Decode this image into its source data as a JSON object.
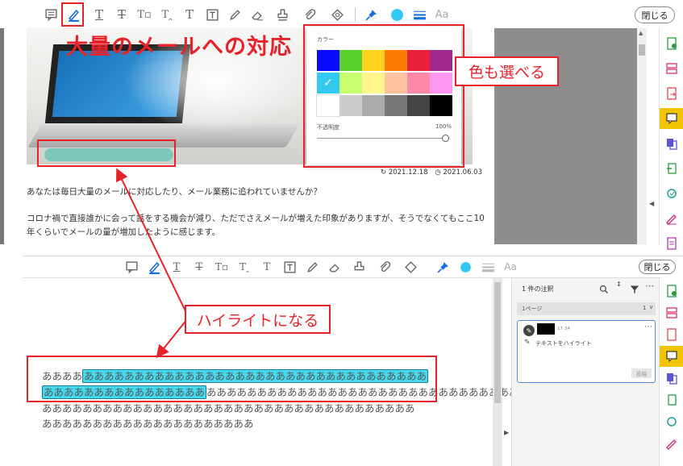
{
  "top": {
    "close_label": "閉じる",
    "aa_label": "Aa",
    "article_title": "大量のメールへの対応",
    "date_updated": "2021.12.18",
    "date_published": "2021.06.03",
    "paragraph1": "あなたは毎日大量のメールに対応したり、メール業務に追われていませんか？",
    "paragraph2_line1": "コロナ禍で直接誰かに会って話をする機会が減り、ただでさえメールが増えた印象がありますが、そうでなくてもここ10",
    "paragraph2_line2": "年くらいでメールの量が増加したように感じます。"
  },
  "color_popup": {
    "title": "カラー",
    "opacity_label": "不透明度",
    "opacity_value": "100%",
    "selected_color": "#32c8f0",
    "swatches": [
      [
        "#0a0aff",
        "#5ad22c",
        "#ffd21e",
        "#ff7a00",
        "#e8203a",
        "#a0288c"
      ],
      [
        "#32c8f0",
        "#c8ff6e",
        "#fff58c",
        "#ffc3a0",
        "#ff88a8",
        "#ff96f0"
      ],
      [
        "#ffffff",
        "#cccccc",
        "#aaaaaa",
        "#777777",
        "#444444",
        "#000000"
      ]
    ]
  },
  "callouts": {
    "color_choice": "色も選べる",
    "becomes_highlight": "ハイライトになる"
  },
  "bottom": {
    "close_label": "閉じる",
    "aa_label": "Aa",
    "text_line1_plain": "ああああ",
    "text_line1_hl": "ああああああああああああああああああああああああああああああああああ",
    "text_line2_hl": "ああああああああああああああああ",
    "text_line2_plain": "ああああああああああああああああああああああああああああああああ",
    "text_line3": "あああああああああああああああああああああああああああああああああああああ",
    "text_line4": "あああああああああああああああああああああ"
  },
  "comments": {
    "header": "1 件の注釈",
    "page_label": "1ページ",
    "page_count": "1",
    "time": "17:34",
    "action": "テキストをハイライト",
    "post_button": "投稿"
  },
  "colors": {
    "accent_red": "#e6232a",
    "highlight": "#45d9ee",
    "rail_active": "#f0c400",
    "toolbar_blue": "#1a6fe0"
  }
}
